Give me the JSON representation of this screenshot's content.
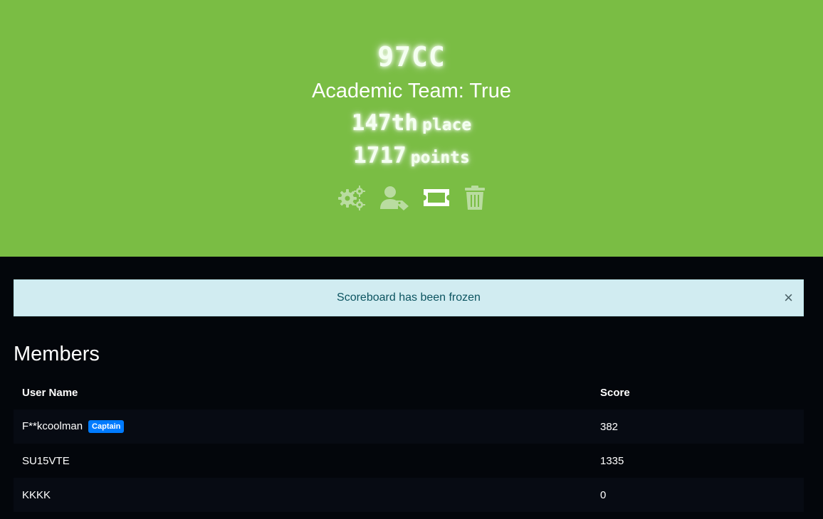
{
  "team": {
    "name": "97CC",
    "academic": "Academic Team: True",
    "place_value": "147th",
    "place_label": "place",
    "points_value": "1717",
    "points_label": "points"
  },
  "actions": [
    {
      "icon": "gears-icon"
    },
    {
      "icon": "user-tag-icon"
    },
    {
      "icon": "ticket-icon"
    },
    {
      "icon": "trash-icon"
    }
  ],
  "alert": {
    "message": "Scoreboard has been frozen",
    "close": "×"
  },
  "members": {
    "title": "Members",
    "columns": [
      "User Name",
      "Score"
    ],
    "rows": [
      {
        "name": "F**kcoolman",
        "badge": "Captain",
        "score": "382"
      },
      {
        "name": "SU15VTE",
        "score": "1335"
      },
      {
        "name": "KKKK",
        "score": "0"
      }
    ]
  },
  "colors": {
    "hero_bg": "#7abd44",
    "page_bg": "#03060b",
    "alert_bg": "#d1ecf1",
    "badge_bg": "#007bff"
  }
}
